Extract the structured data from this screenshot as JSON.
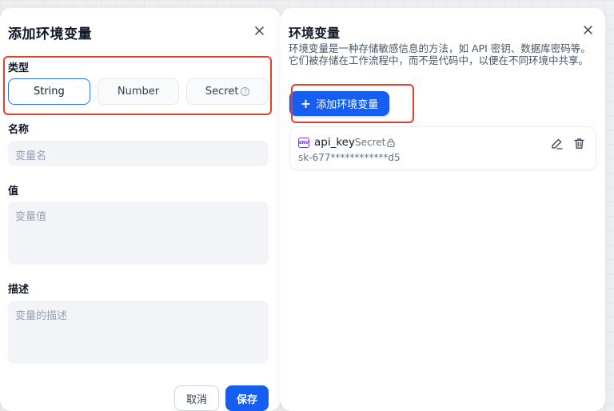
{
  "dialog": {
    "title": "添加环境变量",
    "type_label": "类型",
    "types": [
      {
        "label": "String",
        "active": true
      },
      {
        "label": "Number",
        "active": false
      },
      {
        "label": "Secret",
        "active": false,
        "has_help": true
      }
    ],
    "name_label": "名称",
    "name_placeholder": "变量名",
    "value_label": "值",
    "value_placeholder": "变量值",
    "desc_label": "描述",
    "desc_placeholder": "变量的描述",
    "cancel_label": "取消",
    "save_label": "保存"
  },
  "panel": {
    "title": "环境变量",
    "description": "环境变量是一种存储敏感信息的方法，如 API 密钥、数据库密码等。它们被存储在工作流程中，而不是代码中，以便在不同环境中共享。",
    "add_label": "添加环境变量",
    "variables": [
      {
        "name": "api_key",
        "type": "Secret",
        "value": "sk-677************d5",
        "icon_text": "ENV"
      }
    ]
  },
  "icons": {
    "close": "close-icon",
    "help": "help-circle-icon",
    "plus": "plus-icon",
    "env": "env-icon",
    "lock": "lock-icon",
    "edit": "edit-icon",
    "delete": "trash-icon"
  },
  "colors": {
    "accent": "#155eef",
    "active_border": "#2970ff",
    "highlight": "#e0412f",
    "env_icon": "#6938ef"
  }
}
